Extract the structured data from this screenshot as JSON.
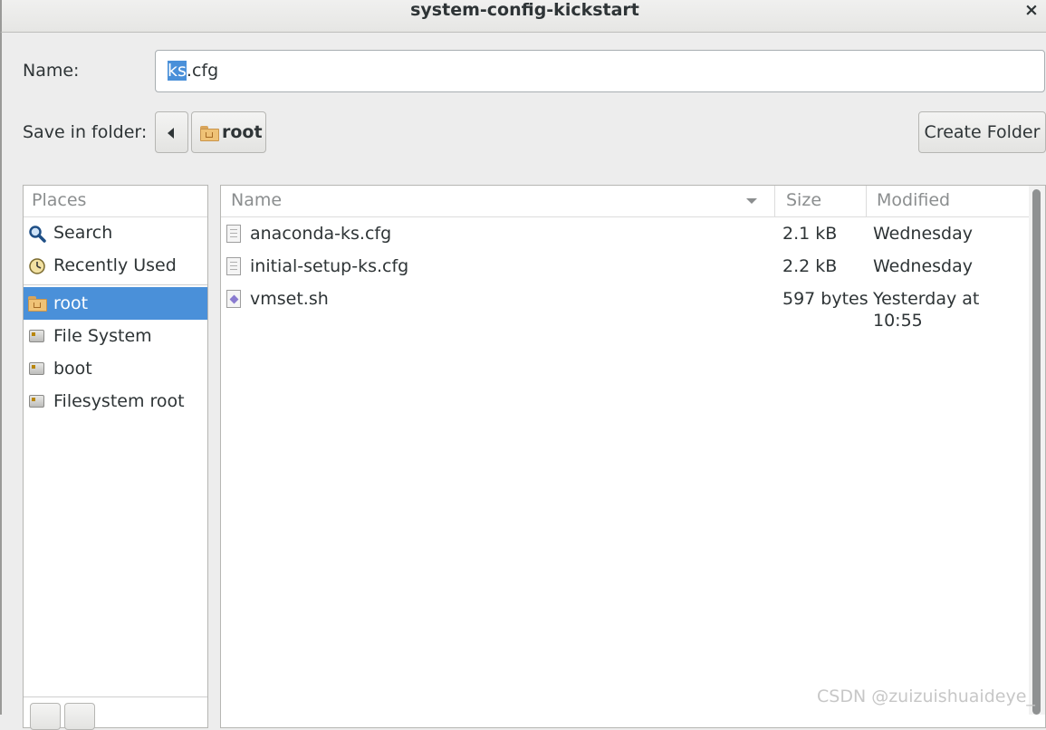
{
  "window": {
    "title": "system-config-kickstart",
    "close_glyph": "×"
  },
  "name_field": {
    "label": "Name:",
    "value_selected": "ks",
    "value_rest": ".cfg"
  },
  "save_in": {
    "label": "Save in folder:",
    "current_folder": "root",
    "create_folder_label": "Create Folder"
  },
  "places": {
    "header": "Places",
    "items": [
      {
        "label": "Search",
        "icon": "search-icon"
      },
      {
        "label": "Recently Used",
        "icon": "recent-icon"
      },
      {
        "label": "root",
        "icon": "home-folder-icon",
        "selected": true
      },
      {
        "label": "File System",
        "icon": "drive-icon"
      },
      {
        "label": "boot",
        "icon": "drive-icon"
      },
      {
        "label": "Filesystem root",
        "icon": "drive-icon"
      }
    ]
  },
  "files": {
    "columns": {
      "name": "Name",
      "size": "Size",
      "modified": "Modified"
    },
    "rows": [
      {
        "name": "anaconda-ks.cfg",
        "size": "2.1 kB",
        "modified": "Wednesday",
        "icon": "text-file-icon"
      },
      {
        "name": "initial-setup-ks.cfg",
        "size": "2.2 kB",
        "modified": "Wednesday",
        "icon": "text-file-icon"
      },
      {
        "name": "vmset.sh",
        "size": "597 bytes",
        "modified": "Yesterday at 10:55",
        "icon": "script-file-icon"
      }
    ]
  },
  "watermark": "CSDN @zuizuishuaideye_",
  "colors": {
    "accent": "#4a90d9",
    "window_bg": "#ededed"
  }
}
